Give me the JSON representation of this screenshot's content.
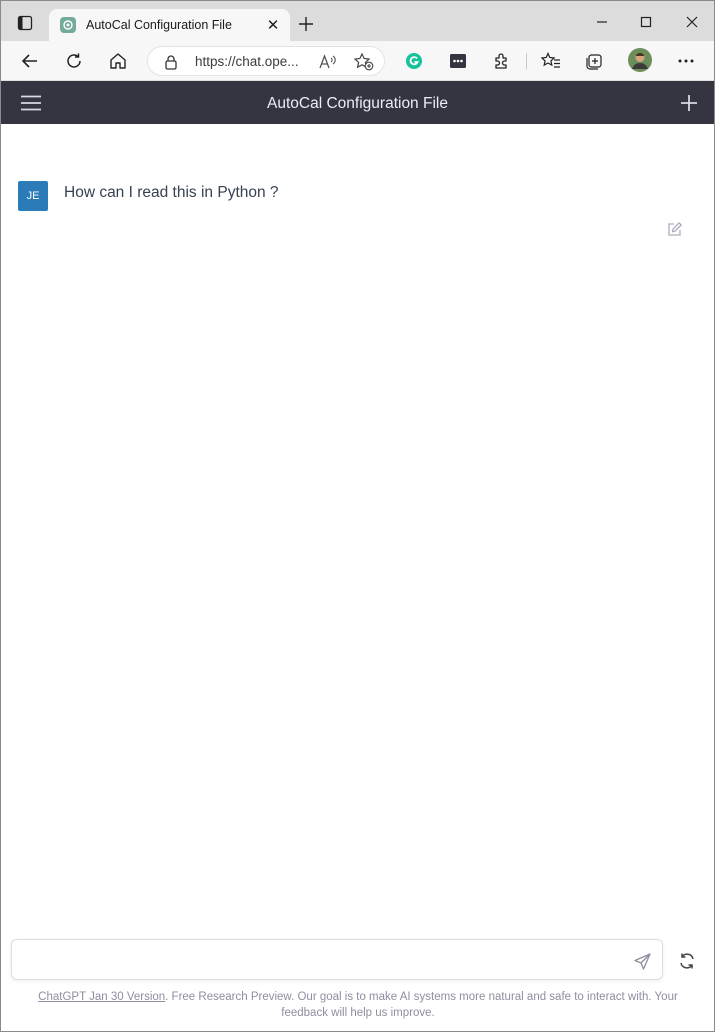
{
  "browser": {
    "tab_title": "AutoCal Configuration File",
    "tab_close_glyph": "✕",
    "url_display": "https://chat.ope...",
    "icons": {
      "tab_actions": "tab-actions-icon",
      "new_tab": "plus-icon",
      "back": "arrow-left-icon",
      "refresh": "refresh-icon",
      "home": "home-icon",
      "lock": "lock-icon",
      "read_aloud": "read-aloud-icon",
      "add_favorite": "star-plus-icon",
      "grammarly": "grammarly-icon",
      "extension_dots": "ellipsis-box-icon",
      "extensions": "puzzle-icon",
      "favorites": "favorites-icon",
      "collections": "collections-icon",
      "profile": "profile-avatar",
      "more": "more-icon",
      "minimize": "minimize-icon",
      "maximize": "maximize-icon",
      "close": "close-icon"
    }
  },
  "app": {
    "title": "AutoCal Configuration File",
    "header_bg": "#343541"
  },
  "conversation": {
    "messages": [
      {
        "role": "user",
        "avatar_initials": "JE",
        "avatar_color": "#2a7bb8",
        "text": "How can I read this in Python ?"
      }
    ]
  },
  "composer": {
    "value": "",
    "placeholder": ""
  },
  "footer": {
    "link_text": "ChatGPT Jan 30 Version",
    "text": ". Free Research Preview. Our goal is to make AI systems more natural and safe to interact with. Your feedback will help us improve."
  }
}
